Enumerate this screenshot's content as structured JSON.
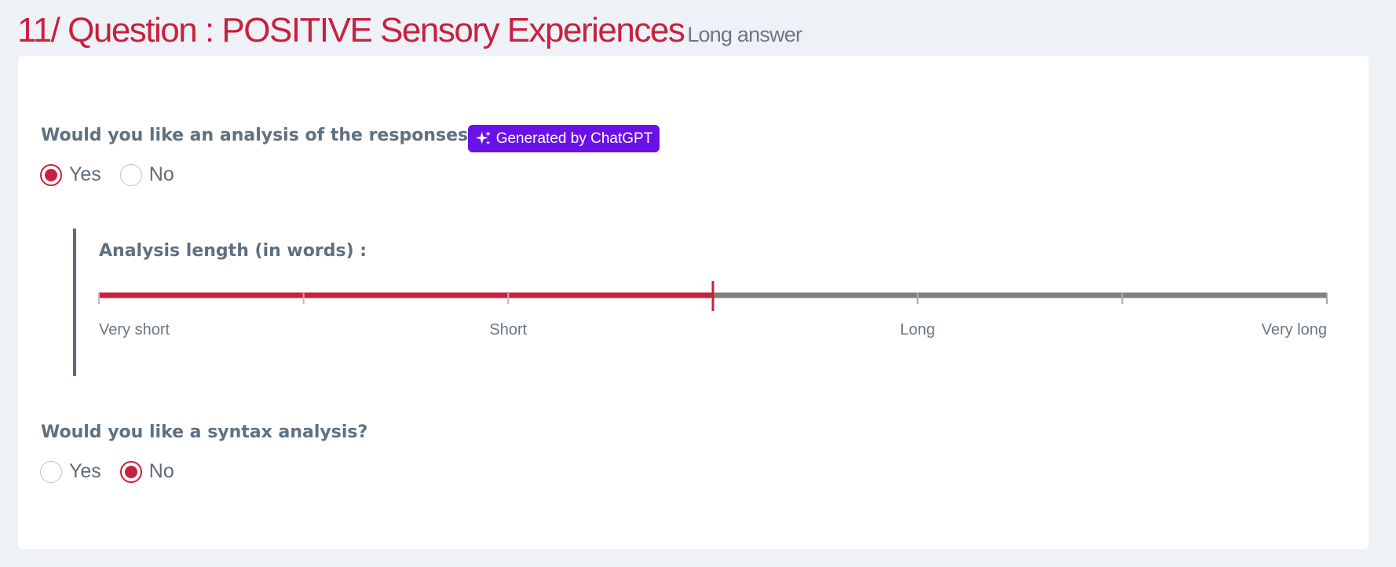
{
  "header": {
    "title": "11/ Question : POSITIVE Sensory Experiences",
    "subtitle": "Long answer"
  },
  "analysis": {
    "question": "Would you like an analysis of the responses?",
    "badge": {
      "label": "Generated by ChatGPT",
      "icon": "sparkles-icon",
      "color": "#6a11e8"
    },
    "options": [
      {
        "label": "Yes",
        "checked": true
      },
      {
        "label": "No",
        "checked": false
      }
    ]
  },
  "length": {
    "title": "Analysis length (in words) :",
    "slider": {
      "positions": 7,
      "selected_index": 3,
      "labels": [
        {
          "index": 0,
          "text": "Very short"
        },
        {
          "index": 2,
          "text": "Short"
        },
        {
          "index": 4,
          "text": "Long"
        },
        {
          "index": 6,
          "text": "Very long"
        }
      ],
      "active_color": "#c8203f",
      "inactive_color": "#808080"
    }
  },
  "syntax": {
    "question": "Would you like a syntax analysis?",
    "options": [
      {
        "label": "Yes",
        "checked": false
      },
      {
        "label": "No",
        "checked": true
      }
    ]
  }
}
